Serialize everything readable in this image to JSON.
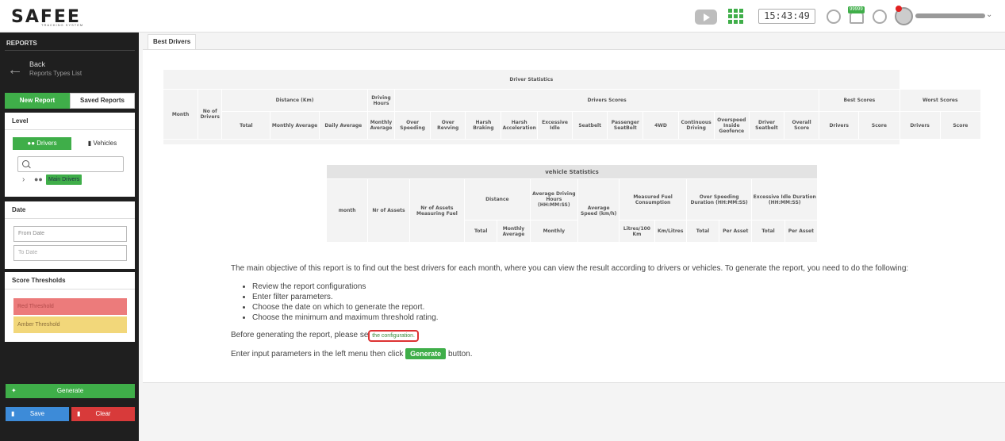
{
  "header": {
    "logo": "SAFEE",
    "logo_sub": "TRACKING SYSTEM",
    "clock": "15:43:49",
    "notification_badge": "99999"
  },
  "sidebar": {
    "title": "REPORTS",
    "back_label": "Back",
    "back_sub": "Reports Types List",
    "tab_new": "New Report",
    "tab_saved": "Saved Reports",
    "level": {
      "heading": "Level",
      "drivers_label": "Drivers",
      "vehicles_label": "Vehicles",
      "search_placeholder": "",
      "tree_node": "Main Drivers"
    },
    "date": {
      "heading": "Date",
      "from_placeholder": "From Date",
      "to_placeholder": "To Date"
    },
    "thresholds": {
      "heading": "Score Thresholds",
      "red_placeholder": "Red Threshold",
      "amber_placeholder": "Amber Threshold",
      "red_color": "#ec7b7b",
      "amber_color": "#f2d77a"
    },
    "generate_label": "Generate",
    "save_label": "Save",
    "clear_label": "Clear"
  },
  "main": {
    "breadcrumb": "Best Drivers",
    "driver_table": {
      "title": "Driver Statistics",
      "month": "Month",
      "no_drivers": "No of Drivers",
      "distance_group": "Distance (Km)",
      "driving_hours_group": "Driving Hours",
      "scores_group": "Drivers Scores",
      "best_group": "Best Scores",
      "worst_group": "Worst Scores",
      "distance_cols": [
        "Total",
        "Monthly Average",
        "Daily Average"
      ],
      "hours_col": "Monthly Average",
      "score_cols": [
        "Over Speeding",
        "Over Revving",
        "Harsh Braking",
        "Harsh Acceleration",
        "Excessive Idle",
        "Seatbelt",
        "Passenger SeatBelt",
        "4WD",
        "Continuous Driving",
        "Overspeed Inside Geofence",
        "Driver Seatbelt",
        "Overall Score"
      ],
      "best_cols": [
        "Drivers",
        "Score"
      ],
      "worst_cols": [
        "Drivers",
        "Score"
      ]
    },
    "vehicle_table": {
      "title": "vehicle Statistics",
      "month": "month",
      "nr_assets": "Nr of Assets",
      "nr_assets_fuel": "Nr of Assets Measuring Fuel",
      "distance_group": "Distance",
      "avg_driving": "Average Driving Hours (HH:MM:SS)",
      "avg_speed": "Average Speed (km/h)",
      "fuel_group": "Measured Fuel Consumption",
      "overspeed_group": "Over Speeding Duration (HH:MM:SS)",
      "idle_group": "Excessive Idle Duration (HH:MM:SS)",
      "distance_cols": [
        "Total",
        "Monthly Average"
      ],
      "driving_col": "Monthly",
      "fuel_cols": [
        "Litres/100 Km",
        "Km/Litres"
      ],
      "overspeed_cols": [
        "Total",
        "Per Asset"
      ],
      "idle_cols": [
        "Total",
        "Per Asset"
      ]
    },
    "description": {
      "intro": "The main objective of this report is to find out the best drivers for each month, where you can view the result according to drivers or vehicles. To generate the report, you need to do the following:",
      "steps": [
        "Review the report configurations",
        "Enter filter parameters.",
        "Choose the date on which to generate the report.",
        "Choose the minimum and maximum threshold rating."
      ],
      "config_prefix": "Before generating the report, please se",
      "config_link": "the configuration.",
      "input_prefix": "Enter input parameters in the left menu then click",
      "generate_button": "Generate",
      "input_suffix": "button."
    }
  }
}
